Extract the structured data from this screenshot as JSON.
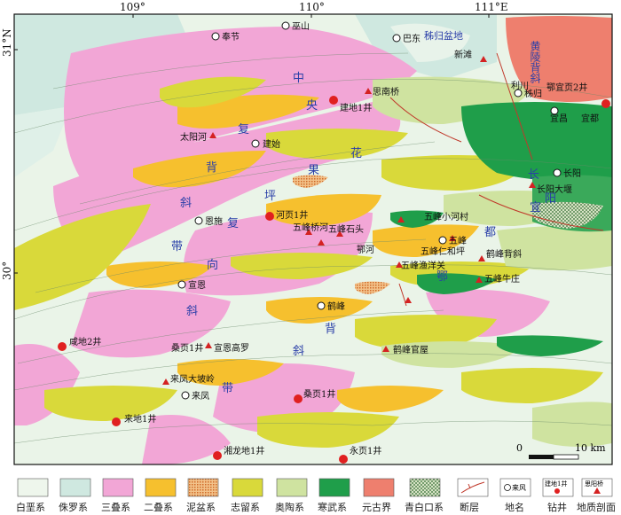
{
  "map": {
    "longitude_labels": [
      "109°",
      "110°",
      "111°E"
    ],
    "latitude_labels": [
      "31°N",
      "30°"
    ],
    "scale_bar": {
      "zero": "0",
      "end": "10 km"
    },
    "places": [
      {
        "name": "奉节"
      },
      {
        "name": "巫山"
      },
      {
        "name": "巴东"
      },
      {
        "name": "秭归盆地"
      },
      {
        "name": "新滩"
      },
      {
        "name": "思南桥"
      },
      {
        "name": "建地1井"
      },
      {
        "name": "秭归"
      },
      {
        "name": "黄陵背斜"
      },
      {
        "name": "鄂宜页2井"
      },
      {
        "name": "宜昌"
      },
      {
        "name": "宜都"
      },
      {
        "name": "长阳"
      },
      {
        "name": "长阳大堰"
      },
      {
        "name": "太阳河"
      },
      {
        "name": "建始"
      },
      {
        "name": "河页1井"
      },
      {
        "name": "恩施"
      },
      {
        "name": "五峰桥河"
      },
      {
        "name": "五峰石头"
      },
      {
        "name": "五峰小河村"
      },
      {
        "name": "五峰"
      },
      {
        "name": "五峰渔洋关"
      },
      {
        "name": "五峰仁和坪"
      },
      {
        "name": "鄂河"
      },
      {
        "name": "鹤峰"
      },
      {
        "name": "鹤峰背斜"
      },
      {
        "name": "宣恩"
      },
      {
        "name": "宣恩高罗"
      },
      {
        "name": "桑页1井"
      },
      {
        "name": "来凤"
      },
      {
        "name": "来凤大坡岭"
      },
      {
        "name": "咸地2井"
      },
      {
        "name": "来地1井"
      },
      {
        "name": "桑页1井"
      },
      {
        "name": "湘龙地1井"
      },
      {
        "name": "永页1井"
      },
      {
        "name": "鹤峰官屋"
      },
      {
        "name": "五峰牛庄"
      },
      {
        "name": "利川"
      }
    ],
    "structure_labels": [
      {
        "text": "中"
      },
      {
        "text": "央"
      },
      {
        "text": "花"
      },
      {
        "text": "果"
      },
      {
        "text": "坪"
      },
      {
        "text": "复"
      },
      {
        "text": "背"
      },
      {
        "text": "斜"
      },
      {
        "text": "带"
      },
      {
        "text": "向"
      },
      {
        "text": "长"
      },
      {
        "text": "阳"
      },
      {
        "text": "都"
      },
      {
        "text": "鄂"
      },
      {
        "text": "宜"
      }
    ]
  },
  "legend": {
    "items": [
      {
        "label": "白垩系",
        "color": "#eef6ec"
      },
      {
        "label": "侏罗系",
        "color": "#cfe8e0"
      },
      {
        "label": "三叠系",
        "color": "#f2a6d6"
      },
      {
        "label": "二叠系",
        "color": "#f6c02e"
      },
      {
        "label": "泥盆系",
        "color": "#e08a3c"
      },
      {
        "label": "志留系",
        "color": "#d9d93a"
      },
      {
        "label": "奥陶系",
        "color": "#cfe3a0"
      },
      {
        "label": "寒武系",
        "color": "#1f9e4a"
      },
      {
        "label": "元古界",
        "color": "#ee7f6e"
      },
      {
        "label": "青白口系",
        "color": "#2f6b2f"
      },
      {
        "label": "断层",
        "color": "#c0392b"
      },
      {
        "label": "地名",
        "color": "#000000",
        "sample": "来风"
      },
      {
        "label": "钻井",
        "color": "#e02020",
        "sample": "建地1井"
      },
      {
        "label": "地质剖面",
        "color": "#c0392b",
        "sample": "思阳桥"
      }
    ]
  }
}
